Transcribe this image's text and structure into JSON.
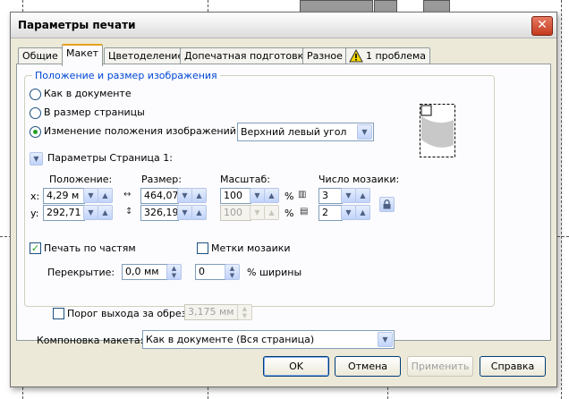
{
  "dialog": {
    "title": "Параметры печати",
    "close_glyph": "✕"
  },
  "tabs": [
    {
      "label": "Общие"
    },
    {
      "label": "Макет"
    },
    {
      "label": "Цветоделение"
    },
    {
      "label": "Допечатная подготовка"
    },
    {
      "label": "Разное"
    },
    {
      "label": "1 проблема"
    }
  ],
  "position_group": {
    "title": "Положение и размер изображения",
    "radio_as_document": "Как в документе",
    "radio_fit_page": "В размер страницы",
    "radio_reposition": "Изменение положения изображений на:",
    "reposition_value": "Верхний левый угол"
  },
  "page_params": {
    "label": "Параметры Страница 1:",
    "col_position": "Положение:",
    "col_size": "Размер:",
    "col_scale": "Масштаб:",
    "col_tiles": "Число мозаики:",
    "x_label": "x:",
    "y_label": "y:",
    "x_value": "4,29 м",
    "y_value": "292,71",
    "width_value": "464,07",
    "height_value": "326,19",
    "scale_x": "100",
    "scale_y": "100",
    "percent": "%",
    "tiles_x": "3",
    "tiles_y": "2"
  },
  "tiling": {
    "print_tiles_label": "Печать по частям",
    "tile_marks_label": "Метки мозаики",
    "overlap_label": "Перекрытие:",
    "overlap_value": "0,0 мм",
    "width_pct_value": "0",
    "width_pct_label": "% ширины"
  },
  "bleed": {
    "label": "Порог выхода за обрез:",
    "value": "3,175 мм"
  },
  "layout": {
    "label": "Компоновка макета:",
    "value": "Как в документе (Вся страница)"
  },
  "buttons": {
    "ok": "OK",
    "cancel": "Отмена",
    "apply": "Применить",
    "help": "Справка"
  },
  "colors": {
    "group_title": "#0046d5",
    "check_green": "#21a121",
    "close_red": "#c33a1f",
    "active_tab_accent": "#e6a11c",
    "warning_yellow": "#f5d800"
  }
}
